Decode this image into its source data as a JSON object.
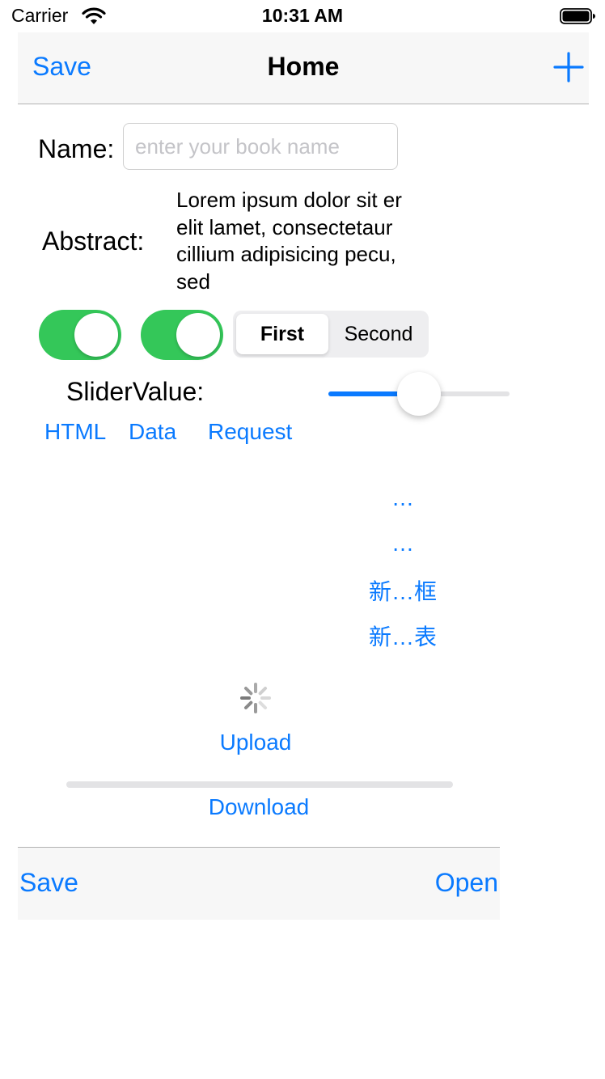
{
  "status_bar": {
    "carrier": "Carrier",
    "time": "10:31 AM",
    "wifi_icon": "wifi-icon",
    "battery_icon": "battery-icon"
  },
  "nav_bar": {
    "left_button": "Save",
    "title": "Home",
    "right_icon": "plus-icon"
  },
  "form": {
    "name_label": "Name:",
    "name_value": "",
    "name_placeholder": "enter your book name",
    "abstract_label": "Abstract:",
    "abstract_text": "Lorem ipsum dolor sit er elit lamet, consectetaur cillium adipisicing pecu, sed"
  },
  "controls": {
    "switch1_on": true,
    "switch2_on": true,
    "segments": [
      "First",
      "Second"
    ],
    "selected_segment": "First",
    "slider_label": "SliderValue:",
    "slider_value": 0.5
  },
  "links": {
    "html": "HTML",
    "data": "Data",
    "request": "Request"
  },
  "menu_buttons": [
    "…",
    "…",
    "新…框",
    "新…表"
  ],
  "transfer": {
    "spinner_icon": "activity-spinner-icon",
    "upload": "Upload",
    "progress": 0,
    "download": "Download"
  },
  "toolbar": {
    "left": "Save",
    "right": "Open"
  },
  "colors": {
    "accent": "#0a7aff",
    "switch_on": "#34c759",
    "bar_background": "#f7f7f7"
  }
}
